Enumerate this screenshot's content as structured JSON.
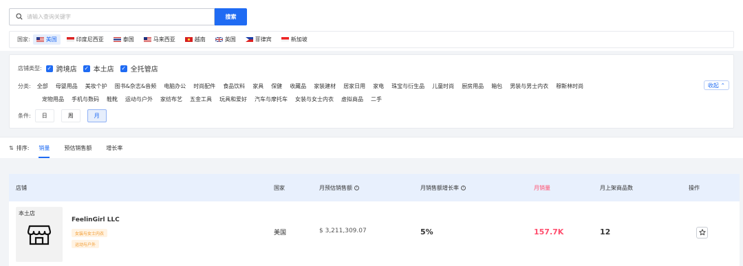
{
  "search": {
    "placeholder": "请输入查询关键字",
    "button_label": "搜索"
  },
  "country": {
    "label": "国家:",
    "items": [
      {
        "name": "美国",
        "active": true
      },
      {
        "name": "印度尼西亚",
        "active": false
      },
      {
        "name": "泰国",
        "active": false
      },
      {
        "name": "马来西亚",
        "active": false
      },
      {
        "name": "越南",
        "active": false
      },
      {
        "name": "英国",
        "active": false
      },
      {
        "name": "菲律宾",
        "active": false
      },
      {
        "name": "新加坡",
        "active": false
      }
    ]
  },
  "store_type": {
    "label": "店铺类型:",
    "options": [
      "跨境店",
      "本土店",
      "全托管店"
    ]
  },
  "category": {
    "label": "分类:",
    "line1": [
      "全部",
      "母婴用品",
      "美妆个护",
      "图书&杂志&音频",
      "电脑办公",
      "时尚配件",
      "食品饮料",
      "家具",
      "保健",
      "收藏品",
      "家装建材",
      "居家日用",
      "家电",
      "珠宝与衍生品",
      "儿童时尚",
      "厨房用品",
      "箱包",
      "男装与男士内衣",
      "穆斯林时尚"
    ],
    "line2": [
      "宠物用品",
      "手机与数码",
      "鞋靴",
      "运动与户外",
      "家纺布艺",
      "五金工具",
      "玩具和爱好",
      "汽车与摩托车",
      "女装与女士内衣",
      "虚拟商品",
      "二手"
    ],
    "collapse_label": "收起 ⌃"
  },
  "condition": {
    "label": "条件:",
    "options": [
      "日",
      "周",
      "月"
    ],
    "active": "月"
  },
  "sort": {
    "label": "排序:",
    "tabs": [
      {
        "label": "销量",
        "active": true
      },
      {
        "label": "预估销售额",
        "active": false
      },
      {
        "label": "增长率",
        "active": false
      }
    ]
  },
  "table": {
    "headers": {
      "store": "店铺",
      "country": "国家",
      "monthly_sales_est": "月预估销售额",
      "monthly_growth": "月销售额增长率",
      "monthly_volume": "月销量",
      "monthly_new_products": "月上架商品数",
      "action": "操作"
    },
    "rows": [
      {
        "badge": "本土店",
        "store_name": "FeelinGirl LLC",
        "tags": [
          "女装与女士内衣",
          "运动与户外"
        ],
        "country": "美国",
        "sales_est": "$ 3,211,309.07",
        "growth": "5%",
        "volume": "157.7K",
        "new_products": "12"
      }
    ]
  },
  "colors": {
    "accent": "#1f6bf3",
    "highlight": "#ff4d6d",
    "tag": "#f29a2e"
  }
}
